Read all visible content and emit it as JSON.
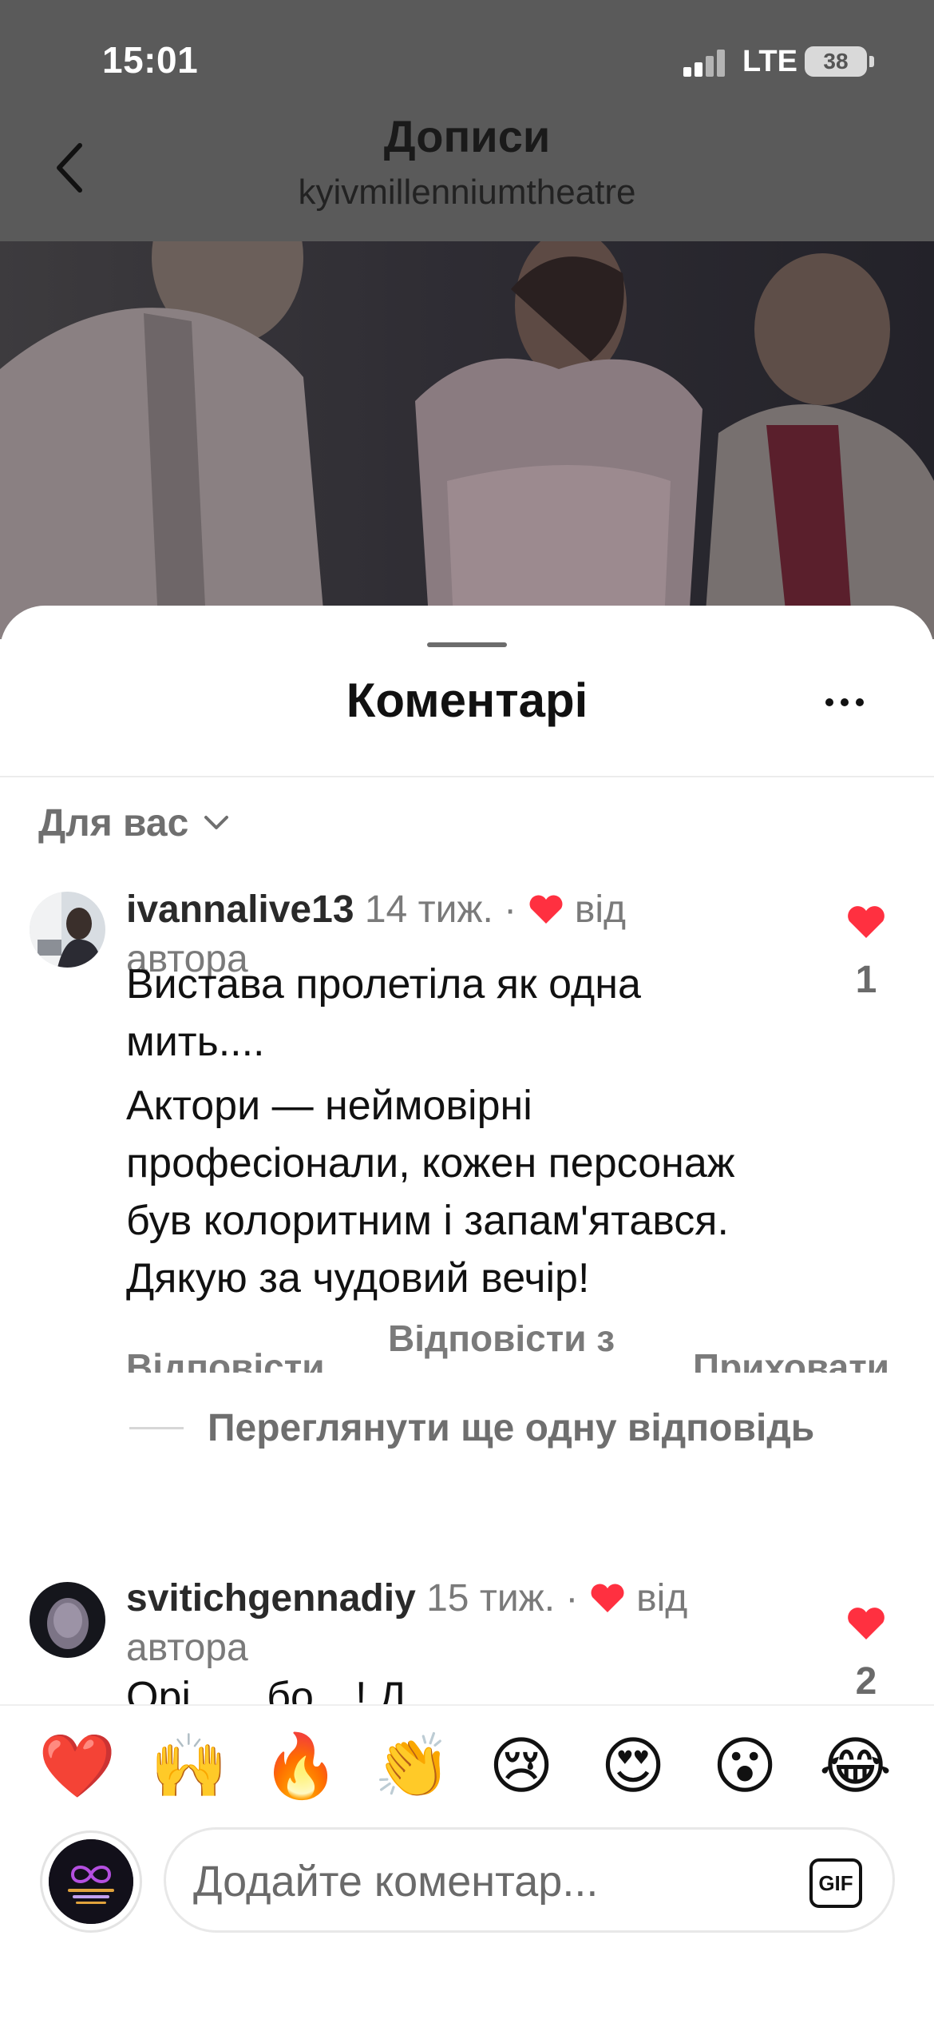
{
  "status_bar": {
    "time": "15:01",
    "network": "LTE",
    "battery": "38"
  },
  "header": {
    "title": "Дописи",
    "subtitle": "kyivmillenniumtheatre"
  },
  "sheet": {
    "title": "Коментарі",
    "filter_label": "Для вас"
  },
  "comments": [
    {
      "username": "ivannalive13",
      "time": "14 тиж.",
      "dot": "·",
      "liked_by_author_line1": "від",
      "liked_by_author_line2": "автора",
      "text": [
        "Вистава пролетіла як одна мить....",
        "Актори — неймовірні професіонали, кожен персонаж був колоритним і запам'ятався.  Дякую за чудовий вечір!"
      ],
      "likes": "1",
      "actions": {
        "reply": "Відповісти",
        "reply_with": "Відповісти з",
        "hide": "Приховати"
      },
      "view_replies": "Переглянути ще одну відповідь"
    },
    {
      "username": "svitichgennadiy",
      "time": "15 тиж.",
      "dot": "·",
      "liked_by_author_line1": "від",
      "liked_by_author_line2": "автора",
      "text_partial": "Орі… ..бо…! Д…",
      "likes": "2"
    }
  ],
  "emoji_bar": [
    "❤️",
    "🙌",
    "🔥",
    "👏",
    "😢",
    "😍",
    "😮",
    "😂"
  ],
  "composer": {
    "placeholder": "Додайте коментар...",
    "gif_label": "GIF",
    "avatar_text": "KYIV MILLENNIUM THEATRE"
  },
  "colors": {
    "like_red": "#ff3040",
    "dim_overlay": "#5a5a5a",
    "muted_text": "#7a7a7a"
  }
}
